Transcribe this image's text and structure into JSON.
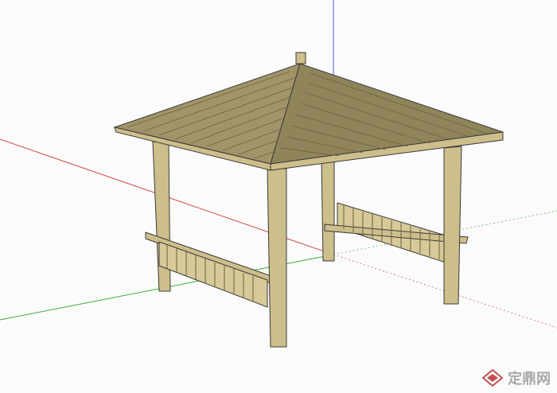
{
  "canvas": {
    "background": "#fbfbfb",
    "axis_colors": {
      "red": "#d04a4a",
      "green": "#3fae3f",
      "blue": "#5a5af0"
    }
  },
  "model": {
    "subject": "pavilion",
    "wood_color": "#cdbf8b",
    "wood_dark": "#a99b67",
    "roof_color": "#a09468",
    "roof_shadow": "#857a52",
    "outline": "#3a3a3a"
  },
  "watermark": {
    "text": "定鼎网",
    "icon": "dingding-logo-icon"
  }
}
